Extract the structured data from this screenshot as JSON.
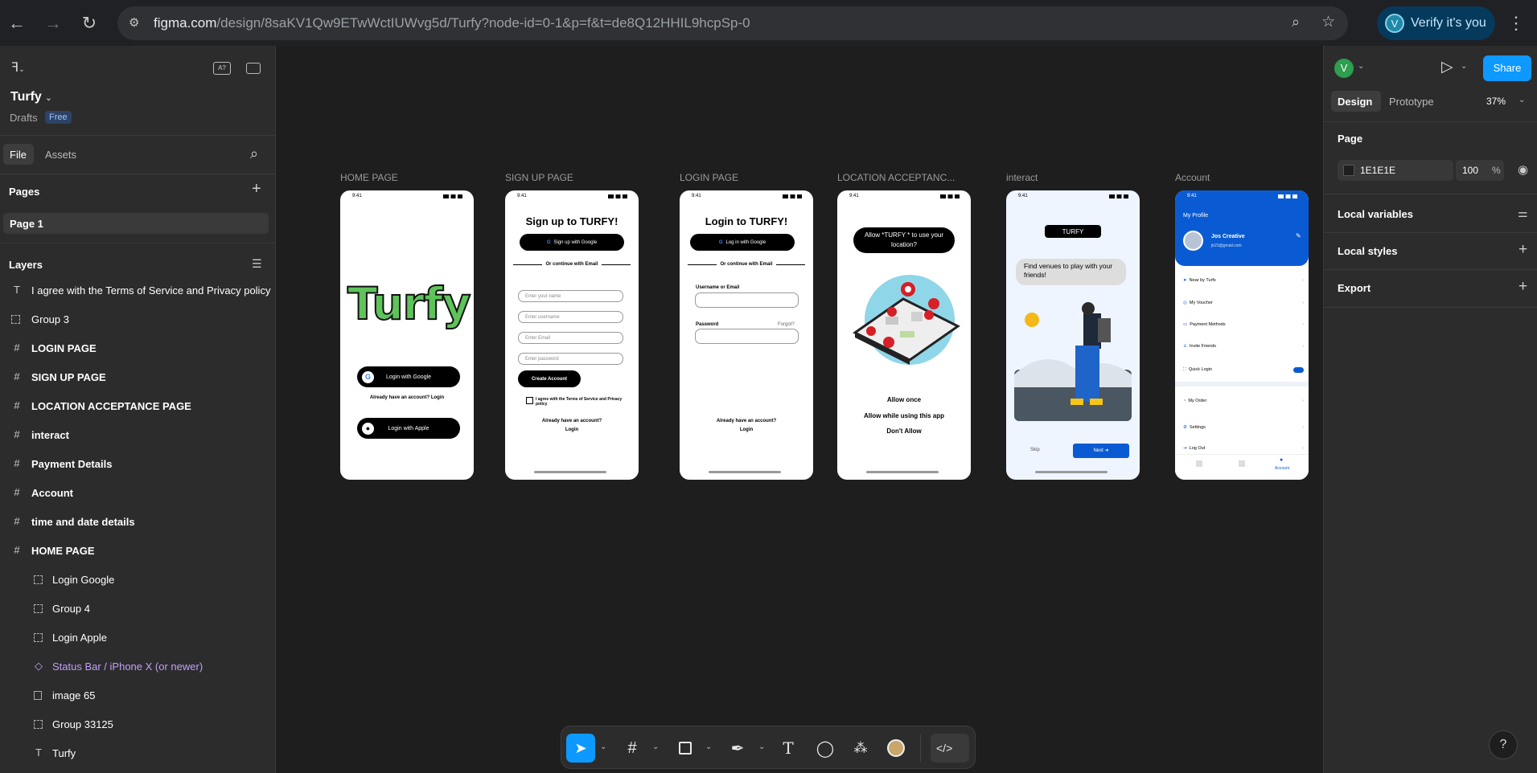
{
  "browser": {
    "url_host": "figma.com",
    "url_path": "/design/8saKV1Qw9ETwWctIUWvg5d/Turfy?node-id=0-1&p=f&t=de8Q12HHIL9hcpSp-0",
    "verify_label": "Verify it's you",
    "avatar_letter": "V"
  },
  "file": {
    "name": "Turfy",
    "location": "Drafts",
    "plan_badge": "Free"
  },
  "left_tabs": {
    "file": "File",
    "assets": "Assets"
  },
  "pages": {
    "heading": "Pages",
    "items": [
      "Page 1"
    ]
  },
  "layers": {
    "heading": "Layers",
    "items": [
      {
        "type": "text",
        "label": "I agree with the Terms of Service and Privacy policy"
      },
      {
        "type": "group",
        "label": "Group 3"
      },
      {
        "type": "frame",
        "label": "LOGIN PAGE"
      },
      {
        "type": "frame",
        "label": "SIGN  UP PAGE"
      },
      {
        "type": "frame",
        "label": "LOCATION ACCEPTANCE PAGE"
      },
      {
        "type": "frame",
        "label": "interact"
      },
      {
        "type": "frame",
        "label": "Payment Details"
      },
      {
        "type": "frame",
        "label": "Account"
      },
      {
        "type": "frame",
        "label": "time and date details"
      },
      {
        "type": "frame",
        "label": "HOME PAGE"
      },
      {
        "type": "group",
        "label": "Login Google"
      },
      {
        "type": "group",
        "label": "Group 4"
      },
      {
        "type": "group",
        "label": "Login Apple"
      },
      {
        "type": "component",
        "label": "Status Bar / iPhone X (or newer)"
      },
      {
        "type": "image",
        "label": "image 65"
      },
      {
        "type": "group",
        "label": "Group 33125"
      },
      {
        "type": "text",
        "label": "Turfy"
      }
    ]
  },
  "frames": {
    "labels": [
      "HOME PAGE",
      "SIGN  UP PAGE",
      "LOGIN PAGE",
      "LOCATION ACCEPTANC...",
      "interact",
      "Account"
    ],
    "status_time": "9:41",
    "home": {
      "logo": "Turfy",
      "google_btn": "Login with Google",
      "have_account": "Already have an account?  Login",
      "apple_btn": "Login with Apple"
    },
    "signup": {
      "title": "Sign up to TURFY!",
      "google_btn": "Sign up with Google",
      "or_email": "Or continue with Email",
      "fields": [
        "Enter your name",
        "Enter username",
        "Enter  Email",
        "Enter password"
      ],
      "create_btn": "Create Account",
      "terms": "I agree with the Terms of Service and Privacy policy",
      "have_account": "Already have an account?",
      "login": "Login"
    },
    "login": {
      "title": "Login  to TURFY!",
      "google_btn": "Log in with Google",
      "or_email": "Or continue with Email",
      "username_label": "Username or Email",
      "password_label": "Password",
      "forgot": "Forgot?",
      "have_account": "Already have an account?",
      "login": "Login"
    },
    "location": {
      "prompt": "Allow  *TURFY * to use your location?",
      "allow_once": "Allow once",
      "allow_while": "Allow while using  this app",
      "dont_allow": "Don't Allow"
    },
    "interact": {
      "badge": "TURFY",
      "bubble": "Find  venues to play with your friends!",
      "skip": "Skip",
      "next": "Next"
    },
    "account": {
      "header": "My Profile",
      "name": "Jos Creative",
      "email": "jtr23@gmail.com",
      "menu": [
        "Near by Turfs",
        "My Voucher",
        "Payment Methods",
        "Invite Friends",
        "Quick Login",
        "My Order",
        "Settings",
        "Log Out"
      ],
      "tab_account": "Account"
    }
  },
  "right_panel": {
    "avatar_letter": "V",
    "share": "Share",
    "tab_design": "Design",
    "tab_prototype": "Prototype",
    "zoom": "37%",
    "page_heading": "Page",
    "bg_hex": "1E1E1E",
    "bg_opacity": "100",
    "pct": "%",
    "local_variables": "Local variables",
    "local_styles": "Local styles",
    "export": "Export"
  },
  "help": "?",
  "colors": {
    "accent": "#0d99ff",
    "canvas": "#1e1e1e",
    "panel": "#2c2c2c",
    "component": "#c29ffb",
    "account_blue": "#0a5bd3",
    "logo_green": "#5ec35a"
  }
}
